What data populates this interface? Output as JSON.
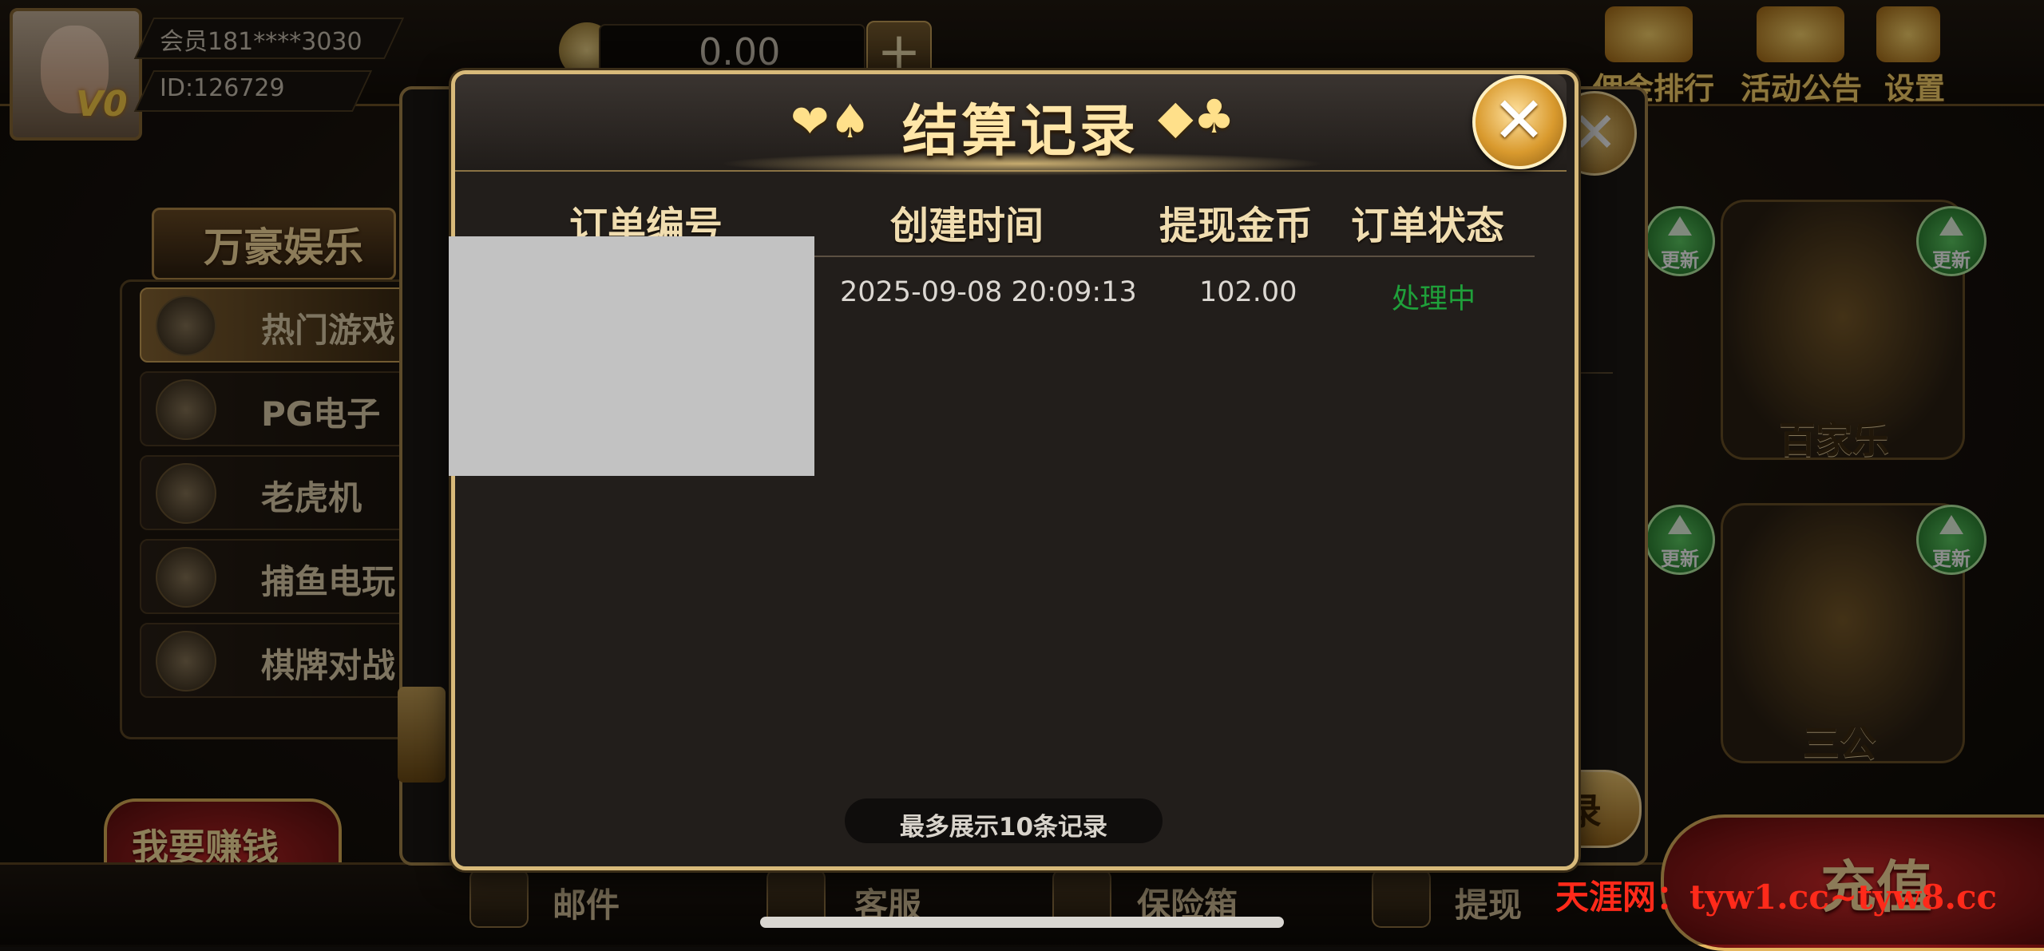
{
  "header": {
    "member_label": "会员181****3030",
    "id_label": "ID:126729",
    "vip_level": "V0",
    "balance": "0.00",
    "add_button": "+",
    "top_menu": [
      "佣金排行",
      "活动公告",
      "设置"
    ]
  },
  "sidebar": {
    "brand": "万豪娱乐",
    "items": [
      {
        "label": "热门游戏",
        "active": true
      },
      {
        "label": "PG电子",
        "active": false
      },
      {
        "label": "老虎机",
        "active": false
      },
      {
        "label": "捕鱼电玩",
        "active": false
      },
      {
        "label": "棋牌对战",
        "active": false
      }
    ],
    "promo": "我要赚钱 月入千万"
  },
  "games": [
    {
      "label": "百家乐",
      "badge": "更新"
    },
    {
      "label": "三公",
      "badge": "更新"
    }
  ],
  "bottom_bar": {
    "items": [
      "邮件",
      "客服",
      "保险箱",
      "提现"
    ],
    "recharge": "充值",
    "watermark": "天涯网：tyw1.cc~tyw8.cc"
  },
  "under_dialog": {
    "record_button_partial": "录"
  },
  "modal": {
    "title": "结算记录",
    "left_suits": "❤♠",
    "right_suits": "◆♣",
    "columns": [
      "订单编号",
      "创建时间",
      "提现金币",
      "订单状态"
    ],
    "rows": [
      {
        "order_id": "",
        "created_at": "2025-09-08 20:09:13",
        "amount": "102.00",
        "status": "处理中"
      }
    ],
    "footer_note": "最多展示10条记录",
    "colors": {
      "status_processing": "#1fa03a",
      "title": "#ffe6a8",
      "border": "#d8ba7a"
    }
  }
}
